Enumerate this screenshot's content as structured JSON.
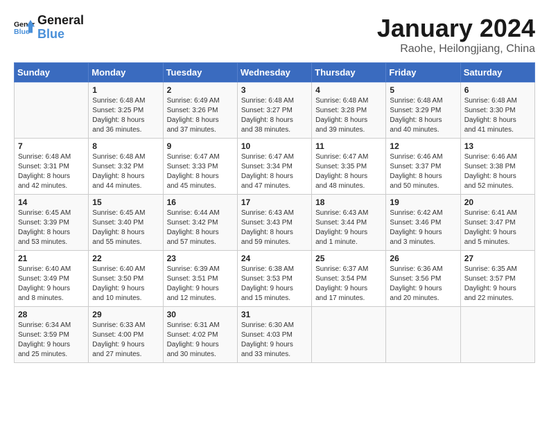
{
  "logo": {
    "line1": "General",
    "line2": "Blue"
  },
  "title": "January 2024",
  "location": "Raohe, Heilongjiang, China",
  "days_of_week": [
    "Sunday",
    "Monday",
    "Tuesday",
    "Wednesday",
    "Thursday",
    "Friday",
    "Saturday"
  ],
  "weeks": [
    [
      {
        "day": "",
        "sunrise": "",
        "sunset": "",
        "daylight": ""
      },
      {
        "day": "1",
        "sunrise": "Sunrise: 6:48 AM",
        "sunset": "Sunset: 3:25 PM",
        "daylight": "Daylight: 8 hours and 36 minutes."
      },
      {
        "day": "2",
        "sunrise": "Sunrise: 6:49 AM",
        "sunset": "Sunset: 3:26 PM",
        "daylight": "Daylight: 8 hours and 37 minutes."
      },
      {
        "day": "3",
        "sunrise": "Sunrise: 6:48 AM",
        "sunset": "Sunset: 3:27 PM",
        "daylight": "Daylight: 8 hours and 38 minutes."
      },
      {
        "day": "4",
        "sunrise": "Sunrise: 6:48 AM",
        "sunset": "Sunset: 3:28 PM",
        "daylight": "Daylight: 8 hours and 39 minutes."
      },
      {
        "day": "5",
        "sunrise": "Sunrise: 6:48 AM",
        "sunset": "Sunset: 3:29 PM",
        "daylight": "Daylight: 8 hours and 40 minutes."
      },
      {
        "day": "6",
        "sunrise": "Sunrise: 6:48 AM",
        "sunset": "Sunset: 3:30 PM",
        "daylight": "Daylight: 8 hours and 41 minutes."
      }
    ],
    [
      {
        "day": "7",
        "sunrise": "Sunrise: 6:48 AM",
        "sunset": "Sunset: 3:31 PM",
        "daylight": "Daylight: 8 hours and 42 minutes."
      },
      {
        "day": "8",
        "sunrise": "Sunrise: 6:48 AM",
        "sunset": "Sunset: 3:32 PM",
        "daylight": "Daylight: 8 hours and 44 minutes."
      },
      {
        "day": "9",
        "sunrise": "Sunrise: 6:47 AM",
        "sunset": "Sunset: 3:33 PM",
        "daylight": "Daylight: 8 hours and 45 minutes."
      },
      {
        "day": "10",
        "sunrise": "Sunrise: 6:47 AM",
        "sunset": "Sunset: 3:34 PM",
        "daylight": "Daylight: 8 hours and 47 minutes."
      },
      {
        "day": "11",
        "sunrise": "Sunrise: 6:47 AM",
        "sunset": "Sunset: 3:35 PM",
        "daylight": "Daylight: 8 hours and 48 minutes."
      },
      {
        "day": "12",
        "sunrise": "Sunrise: 6:46 AM",
        "sunset": "Sunset: 3:37 PM",
        "daylight": "Daylight: 8 hours and 50 minutes."
      },
      {
        "day": "13",
        "sunrise": "Sunrise: 6:46 AM",
        "sunset": "Sunset: 3:38 PM",
        "daylight": "Daylight: 8 hours and 52 minutes."
      }
    ],
    [
      {
        "day": "14",
        "sunrise": "Sunrise: 6:45 AM",
        "sunset": "Sunset: 3:39 PM",
        "daylight": "Daylight: 8 hours and 53 minutes."
      },
      {
        "day": "15",
        "sunrise": "Sunrise: 6:45 AM",
        "sunset": "Sunset: 3:40 PM",
        "daylight": "Daylight: 8 hours and 55 minutes."
      },
      {
        "day": "16",
        "sunrise": "Sunrise: 6:44 AM",
        "sunset": "Sunset: 3:42 PM",
        "daylight": "Daylight: 8 hours and 57 minutes."
      },
      {
        "day": "17",
        "sunrise": "Sunrise: 6:43 AM",
        "sunset": "Sunset: 3:43 PM",
        "daylight": "Daylight: 8 hours and 59 minutes."
      },
      {
        "day": "18",
        "sunrise": "Sunrise: 6:43 AM",
        "sunset": "Sunset: 3:44 PM",
        "daylight": "Daylight: 9 hours and 1 minute."
      },
      {
        "day": "19",
        "sunrise": "Sunrise: 6:42 AM",
        "sunset": "Sunset: 3:46 PM",
        "daylight": "Daylight: 9 hours and 3 minutes."
      },
      {
        "day": "20",
        "sunrise": "Sunrise: 6:41 AM",
        "sunset": "Sunset: 3:47 PM",
        "daylight": "Daylight: 9 hours and 5 minutes."
      }
    ],
    [
      {
        "day": "21",
        "sunrise": "Sunrise: 6:40 AM",
        "sunset": "Sunset: 3:49 PM",
        "daylight": "Daylight: 9 hours and 8 minutes."
      },
      {
        "day": "22",
        "sunrise": "Sunrise: 6:40 AM",
        "sunset": "Sunset: 3:50 PM",
        "daylight": "Daylight: 9 hours and 10 minutes."
      },
      {
        "day": "23",
        "sunrise": "Sunrise: 6:39 AM",
        "sunset": "Sunset: 3:51 PM",
        "daylight": "Daylight: 9 hours and 12 minutes."
      },
      {
        "day": "24",
        "sunrise": "Sunrise: 6:38 AM",
        "sunset": "Sunset: 3:53 PM",
        "daylight": "Daylight: 9 hours and 15 minutes."
      },
      {
        "day": "25",
        "sunrise": "Sunrise: 6:37 AM",
        "sunset": "Sunset: 3:54 PM",
        "daylight": "Daylight: 9 hours and 17 minutes."
      },
      {
        "day": "26",
        "sunrise": "Sunrise: 6:36 AM",
        "sunset": "Sunset: 3:56 PM",
        "daylight": "Daylight: 9 hours and 20 minutes."
      },
      {
        "day": "27",
        "sunrise": "Sunrise: 6:35 AM",
        "sunset": "Sunset: 3:57 PM",
        "daylight": "Daylight: 9 hours and 22 minutes."
      }
    ],
    [
      {
        "day": "28",
        "sunrise": "Sunrise: 6:34 AM",
        "sunset": "Sunset: 3:59 PM",
        "daylight": "Daylight: 9 hours and 25 minutes."
      },
      {
        "day": "29",
        "sunrise": "Sunrise: 6:33 AM",
        "sunset": "Sunset: 4:00 PM",
        "daylight": "Daylight: 9 hours and 27 minutes."
      },
      {
        "day": "30",
        "sunrise": "Sunrise: 6:31 AM",
        "sunset": "Sunset: 4:02 PM",
        "daylight": "Daylight: 9 hours and 30 minutes."
      },
      {
        "day": "31",
        "sunrise": "Sunrise: 6:30 AM",
        "sunset": "Sunset: 4:03 PM",
        "daylight": "Daylight: 9 hours and 33 minutes."
      },
      {
        "day": "",
        "sunrise": "",
        "sunset": "",
        "daylight": ""
      },
      {
        "day": "",
        "sunrise": "",
        "sunset": "",
        "daylight": ""
      },
      {
        "day": "",
        "sunrise": "",
        "sunset": "",
        "daylight": ""
      }
    ]
  ]
}
